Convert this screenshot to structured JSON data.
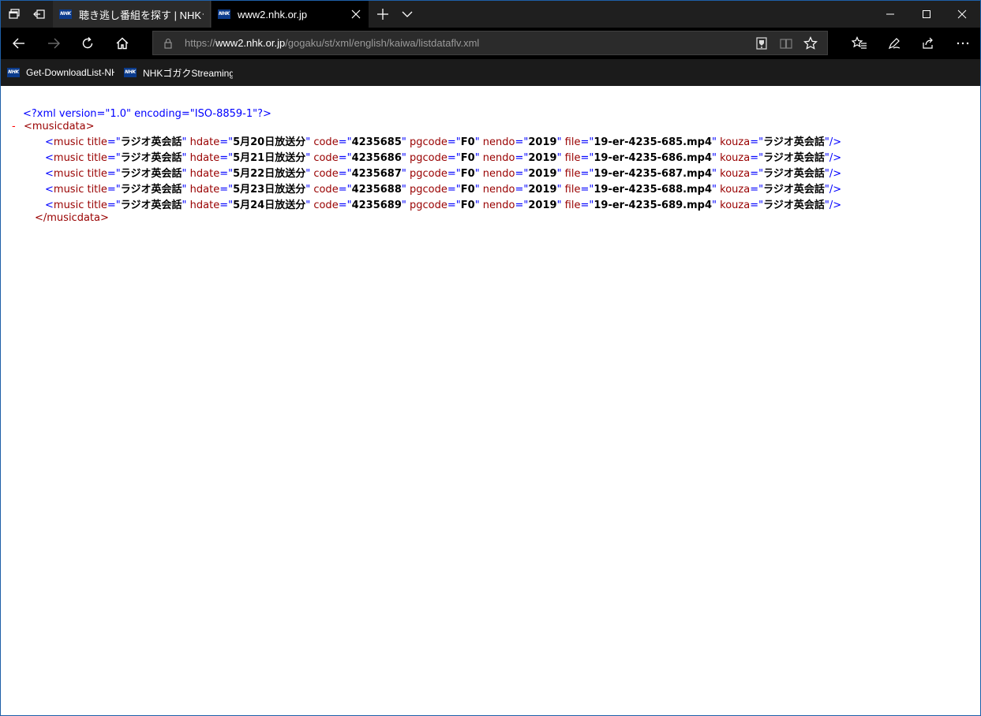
{
  "browser": {
    "tabs": [
      {
        "title": "聴き逃し番組を探す | NHKラジ",
        "active": false
      },
      {
        "title": "www2.nhk.or.jp",
        "active": true
      }
    ],
    "favicon_text": "NHK",
    "address": {
      "scheme": "https://",
      "host": "www2.nhk.or.jp",
      "path": "/gogaku/st/xml/english/kaiwa/listdataflv.xml"
    },
    "favorites": [
      {
        "label": "Get-DownloadList-NH"
      },
      {
        "label": "NHKゴガクStreaming.b"
      }
    ],
    "icons": {
      "tab_manager": "tab-manager-icon",
      "set_aside": "set-aside-tabs-icon",
      "new_tab": "plus-icon",
      "tab_preview": "chevron-down-icon",
      "minimize": "minimize-icon",
      "maximize": "maximize-icon",
      "close": "close-icon",
      "back": "back-arrow-icon",
      "forward": "forward-arrow-icon",
      "refresh": "refresh-icon",
      "home": "home-icon",
      "lock": "lock-icon",
      "extension": "media-icon",
      "reading": "reading-view-icon",
      "favorite": "star-icon",
      "hub": "favorites-hub-icon",
      "ink": "pen-icon",
      "share": "share-icon",
      "more": "more-icon"
    },
    "colors": {
      "chrome": "#1f1f1f",
      "active_tab": "#000000",
      "xml_tag": "#990000",
      "xml_pi": "#0000ff",
      "xml_value": "#000000",
      "collapse_marker": "#ff0000"
    }
  },
  "xml": {
    "declaration": "<?xml version=\"1.0\" encoding=\"ISO-8859-1\"?>",
    "collapse_marker": "-",
    "root_open": "<musicdata>",
    "root_close": "</musicdata>",
    "rows": [
      {
        "title": "ラジオ英会話",
        "hdate": "5月20日放送分",
        "code": "4235685",
        "pgcode": "F0",
        "nendo": "2019",
        "file": "19-er-4235-685.mp4",
        "kouza": "ラジオ英会話"
      },
      {
        "title": "ラジオ英会話",
        "hdate": "5月21日放送分",
        "code": "4235686",
        "pgcode": "F0",
        "nendo": "2019",
        "file": "19-er-4235-686.mp4",
        "kouza": "ラジオ英会話"
      },
      {
        "title": "ラジオ英会話",
        "hdate": "5月22日放送分",
        "code": "4235687",
        "pgcode": "F0",
        "nendo": "2019",
        "file": "19-er-4235-687.mp4",
        "kouza": "ラジオ英会話"
      },
      {
        "title": "ラジオ英会話",
        "hdate": "5月23日放送分",
        "code": "4235688",
        "pgcode": "F0",
        "nendo": "2019",
        "file": "19-er-4235-688.mp4",
        "kouza": "ラジオ英会話"
      },
      {
        "title": "ラジオ英会話",
        "hdate": "5月24日放送分",
        "code": "4235689",
        "pgcode": "F0",
        "nendo": "2019",
        "file": "19-er-4235-689.mp4",
        "kouza": "ラジオ英会話"
      }
    ]
  }
}
